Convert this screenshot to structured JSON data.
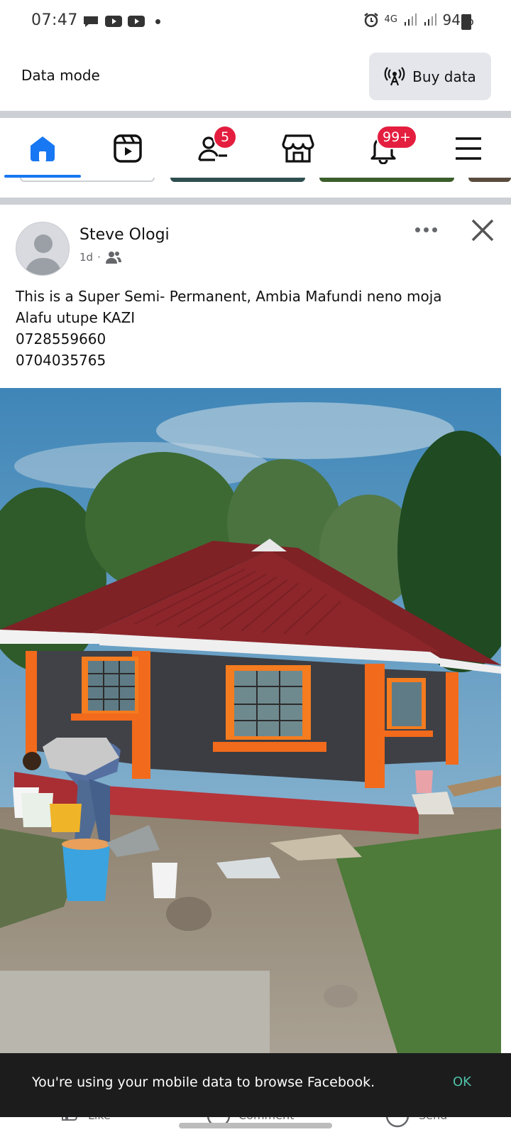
{
  "status_bar": {
    "time": "07:47",
    "network": "4G",
    "battery": "94%"
  },
  "data_mode": {
    "label": "Data mode",
    "buy_button": "Buy data"
  },
  "nav": {
    "items": [
      {
        "name": "home",
        "icon": "home-icon"
      },
      {
        "name": "video",
        "icon": "video-icon"
      },
      {
        "name": "friends",
        "icon": "friends-icon",
        "badge": "5"
      },
      {
        "name": "marketplace",
        "icon": "marketplace-icon"
      },
      {
        "name": "notifications",
        "icon": "bell-icon",
        "badge": "99+"
      },
      {
        "name": "menu",
        "icon": "hamburger-menu-icon"
      }
    ],
    "accent_color": "#1877f2",
    "badge_color": "#e41e3f"
  },
  "post": {
    "author": "Steve Ologi",
    "time": "1d",
    "lines": [
      "This is a Super Semi- Permanent, Ambia Mafundi neno moja",
      "Alafu utupe KAZI",
      "0728559660",
      "0704035765"
    ]
  },
  "snackbar": {
    "message": "You're using your mobile data to browse Facebook.",
    "ok_label": "OK"
  },
  "actions": {
    "like": "Like",
    "comment": "Comment",
    "send": "Send"
  }
}
